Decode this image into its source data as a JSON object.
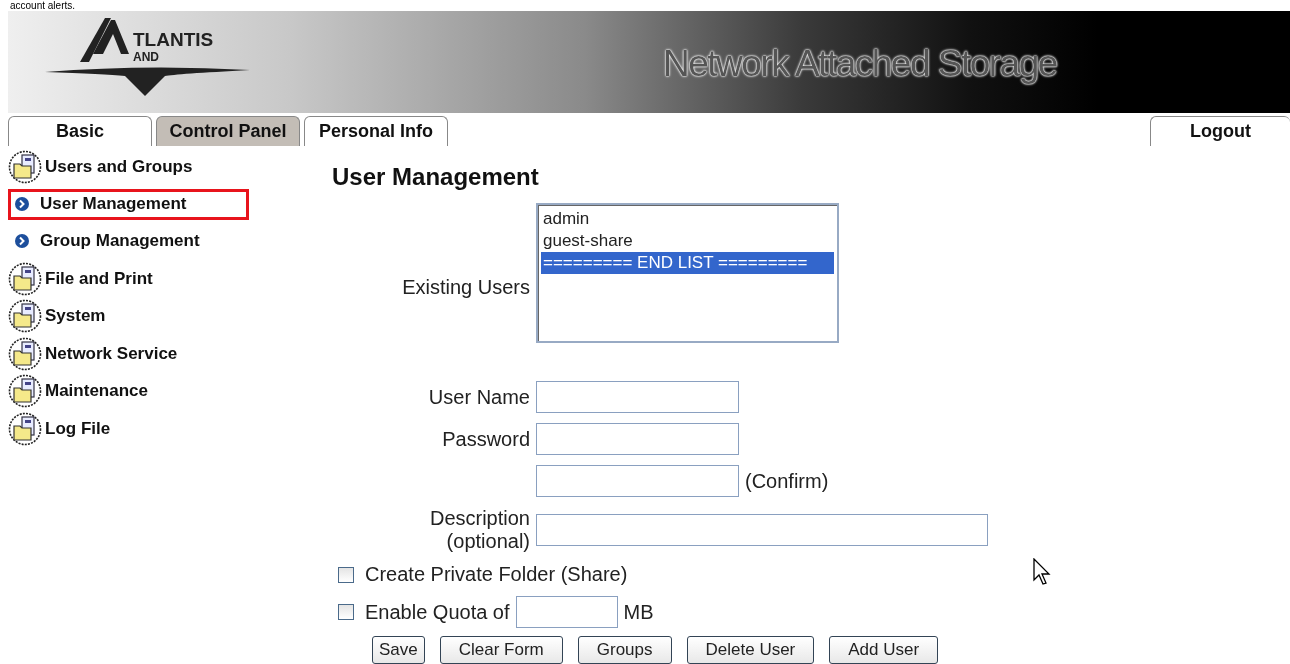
{
  "caption": "account alerts.",
  "header": {
    "logo": {
      "word": "TLANTIS",
      "subword": "AND"
    },
    "title": "Network Attached Storage"
  },
  "tabs": [
    {
      "label": "Basic",
      "selected": false
    },
    {
      "label": "Control Panel",
      "selected": true
    },
    {
      "label": "Personal Info",
      "selected": false
    }
  ],
  "logout": "Logout",
  "sidebar": {
    "items": [
      {
        "label": "Users and Groups",
        "kind": "group",
        "selected": false
      },
      {
        "label": "User Management",
        "kind": "link",
        "selected": true
      },
      {
        "label": "Group Management",
        "kind": "link",
        "selected": false
      },
      {
        "label": "File and Print",
        "kind": "group",
        "selected": false
      },
      {
        "label": "System",
        "kind": "group",
        "selected": false
      },
      {
        "label": "Network Service",
        "kind": "group",
        "selected": false
      },
      {
        "label": "Maintenance",
        "kind": "group",
        "selected": false
      },
      {
        "label": "Log File",
        "kind": "group",
        "selected": false
      }
    ]
  },
  "form": {
    "heading": "User Management",
    "rows": [
      {
        "kind": "list",
        "label": "Existing Users",
        "options": [
          {
            "text": "admin",
            "selected": false
          },
          {
            "text": "guest-share",
            "selected": false
          },
          {
            "text": "========= END LIST =========",
            "selected": true
          }
        ]
      },
      {
        "kind": "text",
        "label": "User Name"
      },
      {
        "kind": "text",
        "label": "Password"
      },
      {
        "kind": "text",
        "suffix": "(Confirm)"
      },
      {
        "kind": "wide",
        "label": "Description\n(optional)"
      },
      {
        "kind": "checkbox",
        "label": "Create Private Folder (Share)",
        "checked": false
      },
      {
        "kind": "quota",
        "label": "Enable Quota of",
        "unit": "MB",
        "checked": false
      }
    ],
    "buttons": [
      "Save",
      "Clear Form",
      "Groups",
      "Delete User",
      "Add User"
    ]
  }
}
